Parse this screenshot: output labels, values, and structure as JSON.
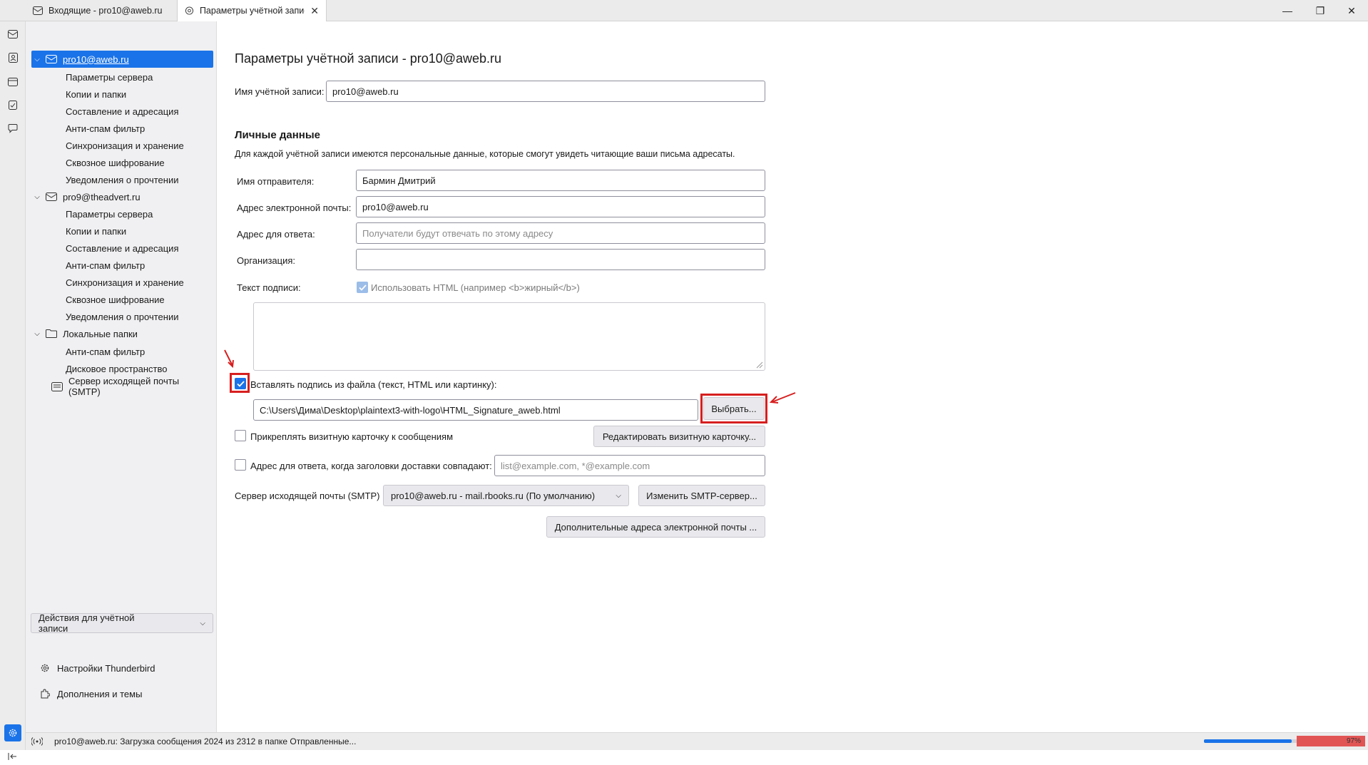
{
  "tabs": [
    {
      "label": "Входящие - pro10@aweb.ru",
      "icon": "mail-icon"
    },
    {
      "label": "Параметры учётной записи",
      "icon": "settings-tab-icon"
    }
  ],
  "window_controls": {
    "minimize": "—",
    "restore": "❐",
    "close": "✕"
  },
  "sidebar": {
    "accounts": [
      {
        "name": "pro10@aweb.ru",
        "items": [
          "Параметры сервера",
          "Копии и папки",
          "Составление и адресация",
          "Анти-спам фильтр",
          "Синхронизация и хранение",
          "Сквозное шифрование",
          "Уведомления о прочтении"
        ]
      },
      {
        "name": "pro9@theadvert.ru",
        "items": [
          "Параметры сервера",
          "Копии и папки",
          "Составление и адресация",
          "Анти-спам фильтр",
          "Синхронизация и хранение",
          "Сквозное шифрование",
          "Уведомления о прочтении"
        ]
      },
      {
        "name": "Локальные папки",
        "items": [
          "Анти-спам фильтр",
          "Дисковое пространство"
        ]
      }
    ],
    "smtp_item": "Сервер исходящей почты (SMTP)",
    "account_actions": "Действия для учётной записи",
    "settings_link": "Настройки Thunderbird",
    "addons_link": "Дополнения и темы"
  },
  "main": {
    "title": "Параметры учётной записи - pro10@aweb.ru",
    "account_name_label": "Имя учётной записи:",
    "account_name_value": "pro10@aweb.ru",
    "personal_heading": "Личные данные",
    "personal_desc": "Для каждой учётной записи имеются персональные данные, которые смогут увидеть читающие ваши письма адресаты.",
    "sender_name_label": "Имя отправителя:",
    "sender_name_value": "Бармин Дмитрий",
    "email_label": "Адрес электронной почты:",
    "email_value": "pro10@aweb.ru",
    "reply_to_label": "Адрес для ответа:",
    "reply_to_placeholder": "Получатели будут отвечать по этому адресу",
    "org_label": "Организация:",
    "org_value": "",
    "signature_label": "Текст подписи:",
    "use_html_label": "Использовать HTML (например <b>жирный</b>)",
    "use_html_checked": true,
    "signature_file_label": "Вставлять подпись из файла (текст, HTML или картинку):",
    "signature_file_checked": true,
    "signature_file_path": "C:\\Users\\Дима\\Desktop\\plaintext3-with-logo\\HTML_Signature_aweb.html",
    "choose_button": "Выбрать...",
    "vcard_label": "Прикреплять визитную карточку к сообщениям",
    "vcard_checked": false,
    "edit_vcard_button": "Редактировать визитную карточку...",
    "reply_from_label": "Адрес для ответа, когда заголовки доставки совпадают:",
    "reply_from_checked": false,
    "reply_from_placeholder": "list@example.com, *@example.com",
    "smtp_label": "Сервер исходящей почты (SMTP)",
    "smtp_value": "pro10@aweb.ru - mail.rbooks.ru (По умолчанию)",
    "change_smtp_button": "Изменить SMTP-сервер...",
    "more_addresses_button": "Дополнительные адреса электронной почты ..."
  },
  "status": {
    "message": "pro10@aweb.ru: Загрузка сообщения 2024 из 2312 в папке Отправленные...",
    "progress_fraction": 0.88,
    "meter_label": "97%"
  },
  "colors": {
    "accent": "#1a73e8",
    "annotation_red": "#d71f1f"
  }
}
